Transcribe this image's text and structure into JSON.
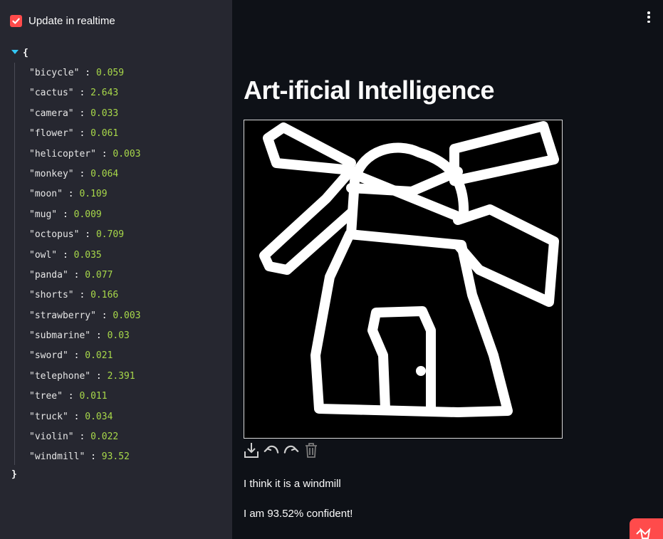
{
  "sidebar": {
    "realtime_checkbox": {
      "label": "Update in realtime",
      "checked": true
    }
  },
  "json_viewer": {
    "open_brace": "{",
    "close_brace": "}",
    "entries": [
      {
        "key": "\"bicycle\"",
        "value": "0.059"
      },
      {
        "key": "\"cactus\"",
        "value": "2.643"
      },
      {
        "key": "\"camera\"",
        "value": "0.033"
      },
      {
        "key": "\"flower\"",
        "value": "0.061"
      },
      {
        "key": "\"helicopter\"",
        "value": "0.003"
      },
      {
        "key": "\"monkey\"",
        "value": "0.064"
      },
      {
        "key": "\"moon\"",
        "value": "0.109"
      },
      {
        "key": "\"mug\"",
        "value": "0.009"
      },
      {
        "key": "\"octopus\"",
        "value": "0.709"
      },
      {
        "key": "\"owl\"",
        "value": "0.035"
      },
      {
        "key": "\"panda\"",
        "value": "0.077"
      },
      {
        "key": "\"shorts\"",
        "value": "0.166"
      },
      {
        "key": "\"strawberry\"",
        "value": "0.003"
      },
      {
        "key": "\"submarine\"",
        "value": "0.03"
      },
      {
        "key": "\"sword\"",
        "value": "0.021"
      },
      {
        "key": "\"telephone\"",
        "value": "2.391"
      },
      {
        "key": "\"tree\"",
        "value": "0.011"
      },
      {
        "key": "\"truck\"",
        "value": "0.034"
      },
      {
        "key": "\"violin\"",
        "value": "0.022"
      },
      {
        "key": "\"windmill\"",
        "value": "93.52"
      }
    ]
  },
  "main": {
    "title": "Art-ificial Intelligence",
    "toolbar": {
      "icons": [
        "download-icon",
        "undo-icon",
        "redo-icon",
        "trash-icon"
      ]
    },
    "result_line_1": "I think it is a windmill",
    "result_line_2": "I am 93.52% confident!"
  },
  "colors": {
    "background": "#0e1117",
    "sidebar": "#262730",
    "accent": "#ff4b4b",
    "json_value": "#a8d84a",
    "caret": "#33c7f4"
  }
}
